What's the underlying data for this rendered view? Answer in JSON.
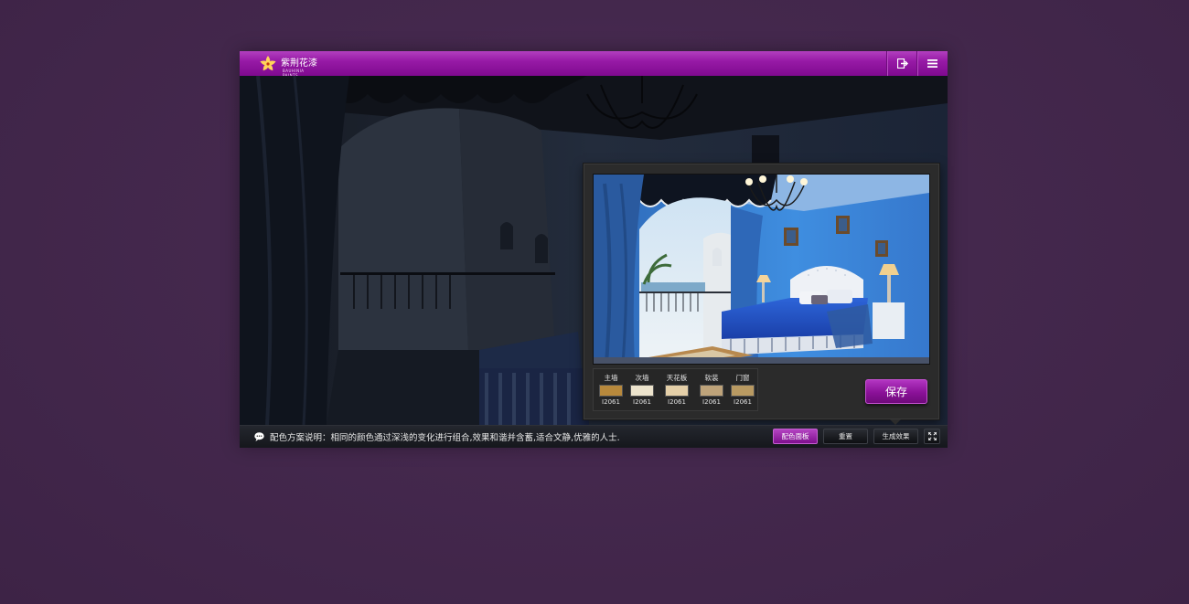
{
  "brand": {
    "name": "紫荆花漆",
    "sub": "BAUHINIA PAINTS"
  },
  "panel": {
    "swatches": [
      {
        "name": "主墙",
        "code": "I2061",
        "color": "#b8893c"
      },
      {
        "name": "次墙",
        "code": "I2061",
        "color": "#ece3cc"
      },
      {
        "name": "天花板",
        "code": "I2061",
        "color": "#e4cfa8"
      },
      {
        "name": "软装",
        "code": "I2061",
        "color": "#bea37a"
      },
      {
        "name": "门窗",
        "code": "I2061",
        "color": "#b99a62"
      }
    ],
    "save_label": "保存"
  },
  "footer": {
    "desc_label": "配色方案说明：",
    "desc_text": "相同的颜色通过深浅的变化进行组合,效果和谐并含蓄,适合文静,优雅的人士.",
    "buttons": {
      "palette": "配色面板",
      "reset": "重置",
      "generate": "生成效果"
    }
  },
  "colors": {
    "brand_purple": "#971aa6",
    "accent_purple": "#b23fbf"
  }
}
